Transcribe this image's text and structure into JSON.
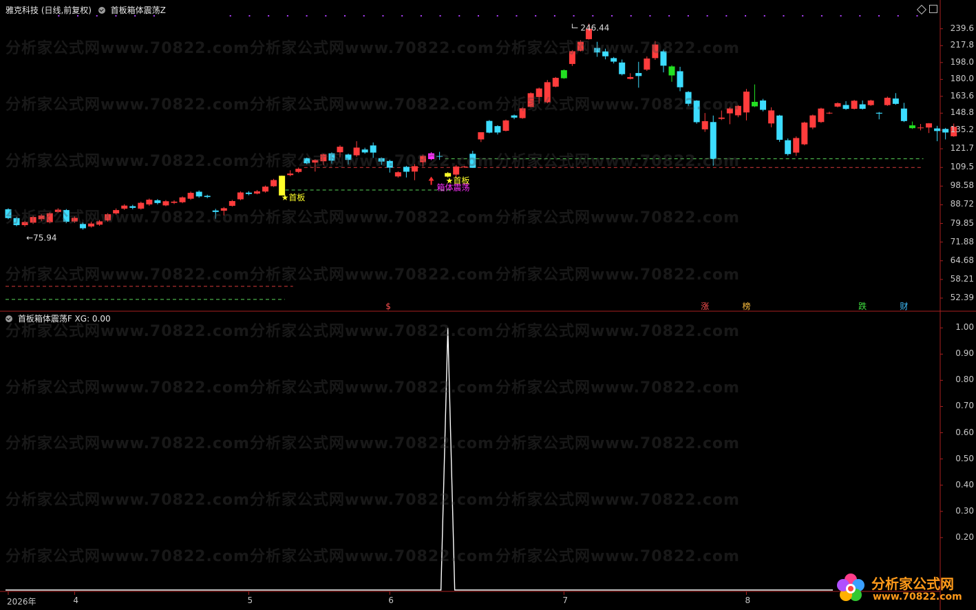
{
  "header": {
    "stock_title": "雅克科技 (日线,前复权)",
    "indicator_main": "首板箱体震荡Z",
    "indicator_sub": "首板箱体震荡F  XG: 0.00"
  },
  "watermark": "分析家公式网www.70822.com",
  "logo": {
    "line1": "分析家公式网",
    "line2": "www.70822.com"
  },
  "colors": {
    "up": "#ff3c3c",
    "down": "#3cdcff",
    "green": "#22e022",
    "axis": "#aa1f1f",
    "yellow": "#ffff2a",
    "magenta": "#ff30ff"
  },
  "chart_data": [
    {
      "type": "candlestick",
      "ylim": [
        50,
        245
      ],
      "y_ticks": [
        "239.6",
        "217.8",
        "198.0",
        "180.0",
        "163.6",
        "148.8",
        "135.2",
        "121.7",
        "109.5",
        "98.58",
        "88.72",
        "79.85",
        "71.88",
        "64.68",
        "58.21",
        "52.39"
      ],
      "y_tick_values": [
        239.6,
        217.8,
        198.0,
        180.0,
        163.6,
        148.8,
        135.2,
        121.7,
        109.5,
        98.58,
        88.72,
        79.85,
        71.88,
        64.68,
        58.21,
        52.39
      ],
      "x_ticks": [
        {
          "label": "2026年",
          "index": 0
        },
        {
          "label": "4",
          "index": 8
        },
        {
          "label": "5",
          "index": 29
        },
        {
          "label": "6",
          "index": 46
        },
        {
          "label": "7",
          "index": 67
        },
        {
          "label": "8",
          "index": 89
        }
      ],
      "annotations": {
        "high_label": "246.44",
        "low_label": "75.94",
        "first_board_1": "★首板",
        "first_board_2": "★首板",
        "box_label": "箱体震荡",
        "events": [
          "$",
          "涨",
          "榜",
          "跌",
          "财"
        ]
      },
      "candles": [
        [
          86.5,
          82.3,
          87.0,
          81.8
        ],
        [
          82.3,
          79.1,
          82.9,
          78.6
        ],
        [
          79.1,
          80.5,
          81.0,
          78.4
        ],
        [
          80.2,
          82.8,
          83.4,
          79.6
        ],
        [
          81.8,
          83.5,
          84.1,
          80.9
        ],
        [
          80.4,
          84.6,
          85.0,
          79.9
        ],
        [
          85.2,
          86.3,
          87.0,
          84.7
        ],
        [
          86.1,
          80.6,
          86.6,
          80.0
        ],
        [
          80.7,
          82.4,
          83.1,
          80.1
        ],
        [
          79.6,
          77.7,
          80.3,
          77.1
        ],
        [
          78.5,
          79.8,
          80.6,
          78.0
        ],
        [
          79.3,
          80.8,
          81.4,
          78.8
        ],
        [
          81.2,
          84.1,
          84.6,
          80.6
        ],
        [
          84.5,
          86.1,
          86.9,
          83.9
        ],
        [
          86.8,
          88.3,
          89.0,
          86.2
        ],
        [
          88.0,
          87.2,
          88.7,
          86.5
        ],
        [
          86.8,
          89.7,
          90.3,
          86.3
        ],
        [
          88.9,
          91.3,
          91.9,
          88.2
        ],
        [
          91.0,
          89.6,
          91.6,
          88.9
        ],
        [
          88.4,
          90.5,
          91.1,
          88.0
        ],
        [
          89.7,
          90.3,
          91.0,
          89.1
        ],
        [
          90.0,
          92.5,
          93.0,
          89.5
        ],
        [
          91.8,
          94.9,
          95.6,
          91.2
        ],
        [
          95.5,
          93.0,
          96.2,
          92.3
        ],
        [
          93.3,
          92.7,
          93.9,
          92.1
        ],
        [
          85.9,
          85.2,
          86.7,
          82.0
        ],
        [
          85.8,
          87.0,
          87.6,
          83.5
        ],
        [
          88.2,
          90.6,
          91.2,
          87.8
        ],
        [
          91.5,
          95.1,
          95.7,
          91.0
        ],
        [
          95.0,
          94.3,
          95.8,
          93.6
        ],
        [
          94.5,
          95.7,
          96.4,
          94.1
        ],
        [
          95.6,
          98.3,
          98.9,
          95.0
        ],
        [
          98.5,
          102.0,
          102.7,
          98.1
        ],
        [
          93.5,
          104.5,
          104.6,
          93.5
        ],
        [
          104.9,
          105.8,
          107.8,
          104.2
        ],
        [
          106.8,
          108.7,
          109.5,
          106.1
        ],
        [
          115.4,
          112.1,
          115.8,
          111.5
        ],
        [
          112.6,
          114.2,
          114.7,
          107.0
        ],
        [
          113.4,
          117.9,
          118.4,
          111.0
        ],
        [
          118.6,
          113.8,
          119.2,
          111.9
        ],
        [
          119.3,
          123.1,
          124.1,
          116.0
        ],
        [
          117.8,
          114.3,
          118.4,
          111.4
        ],
        [
          117.3,
          122.5,
          127.0,
          116.3
        ],
        [
          121.2,
          119.2,
          122.4,
          118.4
        ],
        [
          124.0,
          119.1,
          126.1,
          115.6
        ],
        [
          115.4,
          113.2,
          115.9,
          111.1
        ],
        [
          113.6,
          109.4,
          114.4,
          106.4
        ],
        [
          104.1,
          106.6,
          107.2,
          103.4
        ],
        [
          109.9,
          106.9,
          110.5,
          103.5
        ],
        [
          107.0,
          110.3,
          111.6,
          101.9
        ],
        [
          112.8,
          116.9,
          117.8,
          110.1
        ],
        [
          114.8,
          118.6,
          119.4,
          114.1
        ],
        [
          116.8,
          116.4,
          119.6,
          114.3
        ],
        [
          106.1,
          104.0,
          106.7,
          103.5
        ],
        [
          105.2,
          110.1,
          111.0,
          103.3
        ],
        [
          109.8,
          110.1,
          110.5,
          109.2
        ],
        [
          118.3,
          109.3,
          120.3,
          109.3
        ],
        [
          128.3,
          133.6,
          132.6,
          126.4
        ],
        [
          142.4,
          133.3,
          143.1,
          132.8
        ],
        [
          138.3,
          133.4,
          139.0,
          131.9
        ],
        [
          134.7,
          142.8,
          143.5,
          134.2
        ],
        [
          146.9,
          145.1,
          147.6,
          143.8
        ],
        [
          144.7,
          152.9,
          153.9,
          144.1
        ],
        [
          154.1,
          166.5,
          167.3,
          153.6
        ],
        [
          163.0,
          171.0,
          171.9,
          157.1
        ],
        [
          158.2,
          177.2,
          179.4,
          157.3
        ],
        [
          172.8,
          181.6,
          182.5,
          172.2
        ],
        [
          181.2,
          189.6,
          190.5,
          180.6
        ],
        [
          196.4,
          211.0,
          212.3,
          194.2
        ],
        [
          211.6,
          222.6,
          224.6,
          210.8
        ],
        [
          225.9,
          239.4,
          246.4,
          225.4
        ],
        [
          215.0,
          209.6,
          222.6,
          204.5
        ],
        [
          210.8,
          205.1,
          214.1,
          201.6
        ],
        [
          203.0,
          199.0,
          204.3,
          197.0
        ],
        [
          198.0,
          185.4,
          201.4,
          184.1
        ],
        [
          180.6,
          182.4,
          186.4,
          180.0
        ],
        [
          186.6,
          183.5,
          198.8,
          171.8
        ],
        [
          190.2,
          202.5,
          204.9,
          188.8
        ],
        [
          203.0,
          219.2,
          223.5,
          201.0
        ],
        [
          210.9,
          194.5,
          212.9,
          187.3
        ],
        [
          193.7,
          184.1,
          195.0,
          177.6
        ],
        [
          188.5,
          172.2,
          193.3,
          168.4
        ],
        [
          167.7,
          156.9,
          168.5,
          154.9
        ],
        [
          159.7,
          141.4,
          160.1,
          140.2
        ],
        [
          135.8,
          142.2,
          148.9,
          133.9
        ],
        [
          141.5,
          115.0,
          146.8,
          110.6
        ],
        [
          144.1,
          145.1,
          151.0,
          143.1
        ],
        [
          148.6,
          152.8,
          154.0,
          139.8
        ],
        [
          147.0,
          155.0,
          155.7,
          145.4
        ],
        [
          149.4,
          168.0,
          170.6,
          142.8
        ],
        [
          154.6,
          158.6,
          175.0,
          154.0
        ],
        [
          159.8,
          151.6,
          161.3,
          150.3
        ],
        [
          140.4,
          151.1,
          153.8,
          137.4
        ],
        [
          146.8,
          128.0,
          147.4,
          126.5
        ],
        [
          127.7,
          118.1,
          129.0,
          117.1
        ],
        [
          119.1,
          129.3,
          130.5,
          116.9
        ],
        [
          124.8,
          141.1,
          141.8,
          124.1
        ],
        [
          137.2,
          146.9,
          147.6,
          135.9
        ],
        [
          141.5,
          152.7,
          153.4,
          140.8
        ],
        [
          148.6,
          149.1,
          150.0,
          148.0
        ],
        [
          154.4,
          157.4,
          158.1,
          153.7
        ],
        [
          155.8,
          152.4,
          159.2,
          151.6
        ],
        [
          152.5,
          159.6,
          160.4,
          151.9
        ],
        [
          156.4,
          152.5,
          159.8,
          151.8
        ],
        [
          155.7,
          159.8,
          160.5,
          155.0
        ],
        [
          149.1,
          148.4,
          149.8,
          143.7
        ],
        [
          155.7,
          162.3,
          163.4,
          155.0
        ],
        [
          161.6,
          156.8,
          166.6,
          156.0
        ],
        [
          152.7,
          142.3,
          157.7,
          141.5
        ],
        [
          138.9,
          136.7,
          141.9,
          136.1
        ],
        [
          136.9,
          137.2,
          140.0,
          135.0
        ],
        [
          137.2,
          140.5,
          140.7,
          133.0
        ],
        [
          136.5,
          134.5,
          138.5,
          127.0
        ],
        [
          136.1,
          133.4,
          136.9,
          128.3
        ],
        [
          130.6,
          137.8,
          140.3,
          130.2
        ]
      ],
      "first_board_index": [
        33,
        53
      ],
      "box_signal_index": 51,
      "green_indices": [
        67,
        80,
        90,
        109
      ],
      "event_indices": {
        "$": 46,
        "涨": 84,
        "榜": 89,
        "跌": 103,
        "财": 108
      },
      "box_lines": [
        {
          "value": 56.0,
          "from": 0,
          "to": 34,
          "color": "red"
        },
        {
          "value": 52.0,
          "from": 0,
          "to": 33,
          "color": "green"
        },
        {
          "value": 96.4,
          "from": 33,
          "to": 53,
          "color": "green"
        },
        {
          "value": 109.5,
          "from": 36,
          "to": 110,
          "color": "red"
        },
        {
          "value": 115.0,
          "from": 53,
          "to": 110,
          "color": "green"
        }
      ]
    },
    {
      "type": "line",
      "title": "首板箱体震荡F",
      "ylim": [
        0.08,
        1.04
      ],
      "y_ticks": [
        "1.00",
        "0.90",
        "0.80",
        "0.70",
        "0.60",
        "0.50",
        "0.40",
        "0.30",
        "0.20"
      ],
      "y_tick_values": [
        1.0,
        0.9,
        0.8,
        0.7,
        0.6,
        0.5,
        0.4,
        0.3,
        0.2
      ],
      "spike_index": 53,
      "spike_value": 1.0,
      "baseline_value": 0.0
    }
  ]
}
